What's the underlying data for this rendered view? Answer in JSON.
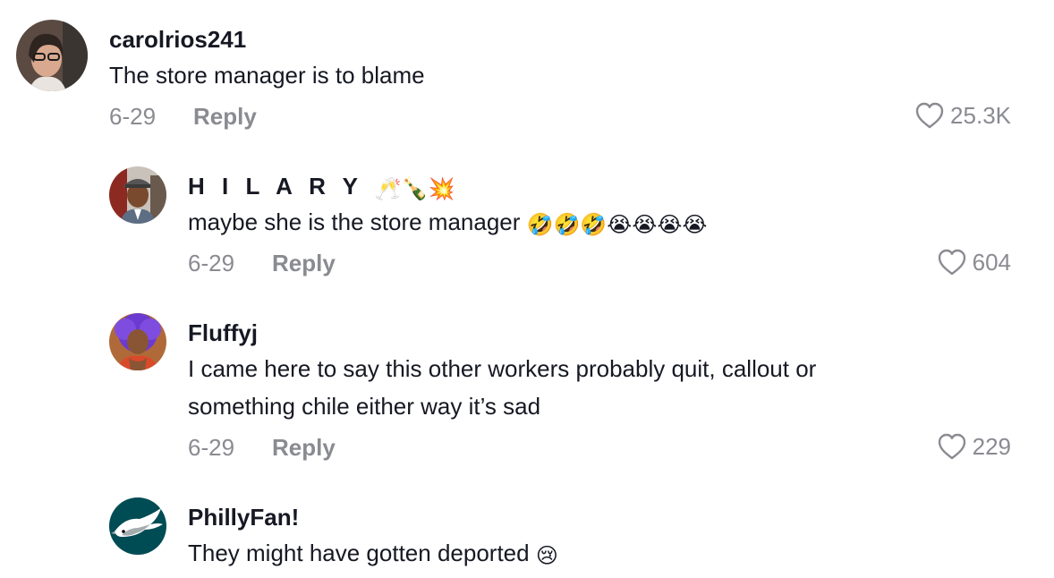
{
  "comments": [
    {
      "username": "carolrios241",
      "text": "The store manager is to blame",
      "date": "6-29",
      "reply_label": "Reply",
      "likes": "25.3K"
    },
    {
      "username": "H I L A R Y",
      "username_emoji": "🥂🍾💥",
      "text": "maybe she is the store manager",
      "text_emoji": "🤣🤣🤣😭😭😭😭",
      "date": "6-29",
      "reply_label": "Reply",
      "likes": "604"
    },
    {
      "username": "Fluffyj",
      "text_line1": "I came here to say this other workers probably quit, callout or",
      "text_line2": "something chile either way it’s sad",
      "date": "6-29",
      "reply_label": "Reply",
      "likes": "229"
    },
    {
      "username": "PhillyFan!",
      "text": "They might have gotten deported",
      "text_emoji": "😢"
    }
  ],
  "colors": {
    "primary_text": "#161823",
    "secondary_text": "#8a8b91",
    "eagles_green": "#004c54"
  },
  "icons": {
    "like": "heart-outline-icon"
  }
}
